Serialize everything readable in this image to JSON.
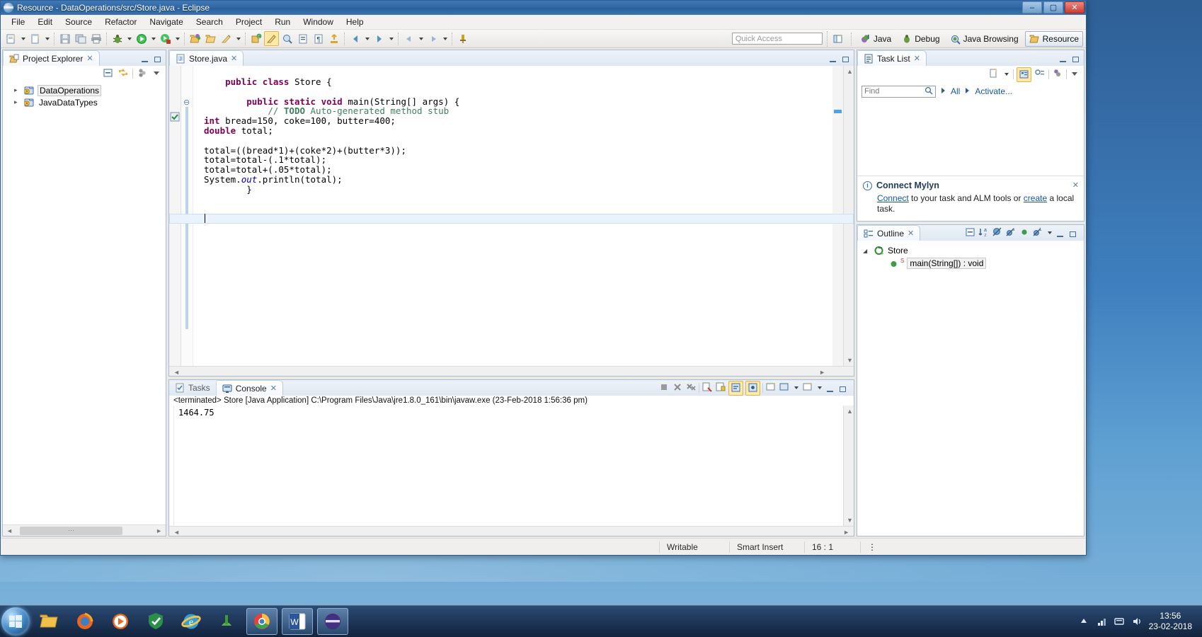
{
  "window": {
    "title": "Resource - DataOperations/src/Store.java - Eclipse",
    "app_icon": "eclipse-globe-icon",
    "minimize": "–",
    "maximize": "▢",
    "close": "✕"
  },
  "menubar": {
    "items": [
      "File",
      "Edit",
      "Source",
      "Refactor",
      "Navigate",
      "Search",
      "Project",
      "Run",
      "Window",
      "Help"
    ]
  },
  "toolbar": {
    "quick_access_placeholder": "Quick Access",
    "buttons": [
      "new-wizard-icon",
      "new-item-icon",
      "save-icon",
      "save-all-icon",
      "print-icon",
      "debug-icon",
      "run-icon",
      "run-external-tools-icon",
      "open-type-icon",
      "open-task-icon",
      "toggle-markoccurrences-icon",
      "new-java-package-icon",
      "search-icon",
      "next-annotation-icon",
      "previous-annotation-icon",
      "back-icon",
      "forward-icon",
      "pin-editor-icon"
    ]
  },
  "perspectives": {
    "switcher_icon": "open-perspective-icon",
    "items": [
      {
        "label": "Java",
        "icon": "java-perspective-icon",
        "selected": false
      },
      {
        "label": "Debug",
        "icon": "debug-perspective-icon",
        "selected": false
      },
      {
        "label": "Java Browsing",
        "icon": "java-browsing-perspective-icon",
        "selected": false
      },
      {
        "label": "Resource",
        "icon": "resource-perspective-icon",
        "selected": true
      }
    ]
  },
  "project_explorer": {
    "tab_label": "Project Explorer",
    "tab_icon": "project-explorer-icon",
    "close_glyph": "✕",
    "toolbar_icons": [
      "collapse-all-icon",
      "link-with-editor-icon",
      "view-menu-icon",
      "view-dropdown-icon"
    ],
    "minimize_glyph": "—",
    "maximize_glyph": "▢",
    "items": [
      {
        "label": "DataOperations",
        "icon": "java-project-icon",
        "expander": "▸",
        "selected": true
      },
      {
        "label": "JavaDataTypes",
        "icon": "java-project-icon",
        "expander": "▸",
        "selected": false
      }
    ],
    "hscroll_handle": "⋯"
  },
  "editor": {
    "tab_label": "Store.java",
    "tab_icon": "java-file-icon",
    "close_glyph": "✕",
    "minimize_glyph": "—",
    "maximize_glyph": "▢",
    "fold_glyph": "⊖",
    "code_lines": [
      {
        "indent": 1,
        "tokens": [
          {
            "t": "public ",
            "c": "kw"
          },
          {
            "t": "class ",
            "c": "kw"
          },
          {
            "t": "Store {",
            "c": ""
          }
        ]
      },
      {
        "indent": 0,
        "tokens": []
      },
      {
        "indent": 2,
        "tokens": [
          {
            "t": "public ",
            "c": "kw"
          },
          {
            "t": "static ",
            "c": "kw"
          },
          {
            "t": "void ",
            "c": "kw"
          },
          {
            "t": "main(String[] args) {",
            "c": ""
          }
        ]
      },
      {
        "indent": 3,
        "tokens": [
          {
            "t": "// ",
            "c": "cmt"
          },
          {
            "t": "TODO",
            "c": "todo"
          },
          {
            "t": " Auto-generated method stub",
            "c": "cmt"
          }
        ]
      },
      {
        "indent": 0,
        "tokens": [
          {
            "t": "int ",
            "c": "kw"
          },
          {
            "t": "bread=150, coke=100, butter=400;",
            "c": ""
          }
        ]
      },
      {
        "indent": 0,
        "tokens": [
          {
            "t": "double ",
            "c": "kw"
          },
          {
            "t": "total;",
            "c": ""
          }
        ]
      },
      {
        "indent": 0,
        "tokens": []
      },
      {
        "indent": 0,
        "tokens": [
          {
            "t": "total=((bread*1)+(coke*2)+(butter*3));",
            "c": ""
          }
        ]
      },
      {
        "indent": 0,
        "tokens": [
          {
            "t": "total=total-(.1*total);",
            "c": ""
          }
        ]
      },
      {
        "indent": 0,
        "tokens": [
          {
            "t": "total=total+(.05*total);",
            "c": ""
          }
        ]
      },
      {
        "indent": 0,
        "tokens": [
          {
            "t": "System.",
            "c": ""
          },
          {
            "t": "out",
            "c": "fld"
          },
          {
            "t": ".println(total);",
            "c": ""
          }
        ]
      },
      {
        "indent": 2,
        "tokens": [
          {
            "t": "}",
            "c": ""
          }
        ]
      },
      {
        "indent": 0,
        "tokens": []
      },
      {
        "indent": 0,
        "tokens": []
      },
      {
        "indent": 0,
        "tokens": [
          {
            "t": "}",
            "c": ""
          }
        ]
      }
    ]
  },
  "bottom_panel": {
    "tabs": [
      {
        "label": "Tasks",
        "icon": "tasks-icon",
        "active": false
      },
      {
        "label": "Console",
        "icon": "console-icon",
        "active": true
      }
    ],
    "close_glyph": "✕",
    "minimize_glyph": "—",
    "maximize_glyph": "▢",
    "toolbar_icons": [
      "terminate-icon",
      "remove-launch-icon",
      "remove-all-terminated-icon",
      "clear-console-icon",
      "scroll-lock-icon",
      "word-wrap-icon",
      "pin-console-icon",
      "display-selected-console-icon",
      "open-console-icon",
      "view-menu-icon"
    ],
    "console_header": "<terminated> Store [Java Application] C:\\Program Files\\Java\\jre1.8.0_161\\bin\\javaw.exe (23-Feb-2018 1:56:36 pm)",
    "console_output": "1464.75"
  },
  "task_list": {
    "tab_label": "Task List",
    "tab_icon": "task-list-icon",
    "close_glyph": "✕",
    "minimize_glyph": "—",
    "maximize_glyph": "▢",
    "toolbar_icons": [
      "new-task-icon",
      "new-task-dropdown-icon",
      "categorized-presentation-icon",
      "scheduled-presentation-icon",
      "focus-on-workweek-icon",
      "view-menu-icon"
    ],
    "find_placeholder": "Find",
    "find_icon": "search-icon",
    "filter_all": "All",
    "filter_activate": "Activate...",
    "mylyn": {
      "icon": "info-icon",
      "title": "Connect Mylyn",
      "link_connect": "Connect",
      "text_part1": " to your task and ALM tools or ",
      "link_create": "create",
      "text_part2": " a local task.",
      "close_glyph": "✕"
    }
  },
  "outline": {
    "tab_label": "Outline",
    "tab_icon": "outline-icon",
    "close_glyph": "✕",
    "minimize_glyph": "—",
    "maximize_glyph": "▢",
    "toolbar_icons": [
      "collapse-all-icon",
      "sort-icon",
      "hide-fields-icon",
      "hide-static-icon",
      "hide-nonpublic-icon",
      "hide-local-types-icon",
      "view-menu-icon"
    ],
    "items": [
      {
        "label": "Store",
        "icon": "java-class-icon",
        "expander": "◢",
        "depth": 0,
        "selected": false
      },
      {
        "label": "main(String[]) : void",
        "icon": "public-method-icon",
        "badge": "S",
        "depth": 1,
        "selected": true
      }
    ]
  },
  "status_bar": {
    "writable": "Writable",
    "insert_mode": "Smart Insert",
    "cursor_position": "16 : 1",
    "menu_glyph": "⋮"
  },
  "taskbar": {
    "start_icon": "windows-start-orb",
    "items": [
      {
        "icon": "file-explorer-icon",
        "active": false
      },
      {
        "icon": "firefox-icon",
        "active": false
      },
      {
        "icon": "media-player-icon",
        "active": false
      },
      {
        "icon": "shield-antivirus-icon",
        "active": false
      },
      {
        "icon": "internet-explorer-icon",
        "active": false
      },
      {
        "icon": "utorrent-icon",
        "active": false
      },
      {
        "icon": "google-chrome-icon",
        "active": true
      },
      {
        "icon": "word-icon",
        "active": true
      },
      {
        "icon": "eclipse-icon",
        "active": true
      }
    ],
    "tray_icons": [
      "show-hidden-icons-icon",
      "network-icon",
      "action-center-icon",
      "volume-icon"
    ],
    "clock_time": "13:56",
    "clock_date": "23-02-2018"
  },
  "colors": {
    "title_blue": "#2f67a5",
    "accent_link": "#15569e",
    "keyword": "#7f0055",
    "comment": "#3f7f5f",
    "field": "#0000c0",
    "selection": "#eaf2fb"
  }
}
